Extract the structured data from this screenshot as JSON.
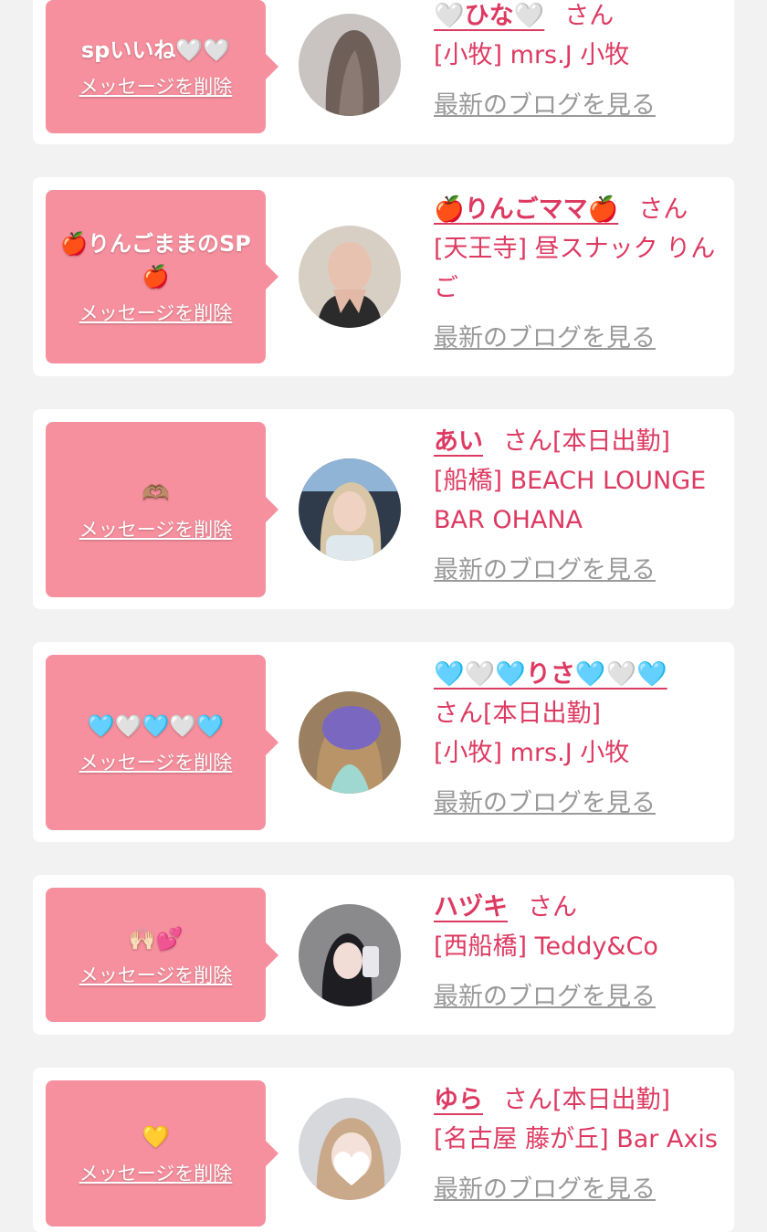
{
  "delete_label": "メッセージを削除",
  "blog_label": "最新のブログを見る",
  "san_label": "さん",
  "colors": {
    "background": "#f2f2f2",
    "bubble": "#f7909e",
    "name": "#dd3a62",
    "link_gray": "#9a9a9a"
  },
  "entries": [
    {
      "message": "spいいね🤍🤍",
      "name": "🤍ひな🤍",
      "status": "",
      "shop": "[小牧] mrs.J 小牧",
      "avatar": "avatar-photo-long-hair"
    },
    {
      "message": "🍎りんごままのSP🍎",
      "name": "🍎りんごママ🍎",
      "status": "",
      "shop": "[天王寺] 昼スナック りんご",
      "avatar": "avatar-photo-hands"
    },
    {
      "message": "🫶🏽",
      "name": "あい",
      "status": "[本日出勤]",
      "shop": "[船橋] BEACH LOUNGE BAR OHANA",
      "avatar": "avatar-photo-blonde"
    },
    {
      "message": "🩵🤍🩵🤍🩵",
      "name": "🩵🤍🩵りさ🩵🤍🩵",
      "status": "[本日出勤]",
      "shop": "[小牧] mrs.J 小牧",
      "avatar": "avatar-photo-purple-mask"
    },
    {
      "message": "🙌🏻💕",
      "name": "ハヅキ",
      "status": "",
      "shop": "[西船橋] Teddy&Co",
      "avatar": "avatar-photo-selfie"
    },
    {
      "message": "💛",
      "name": "ゆら",
      "status": "[本日出勤]",
      "shop": "[名古屋 藤が丘] Bar Axis",
      "avatar": "avatar-photo-heart-face"
    }
  ]
}
